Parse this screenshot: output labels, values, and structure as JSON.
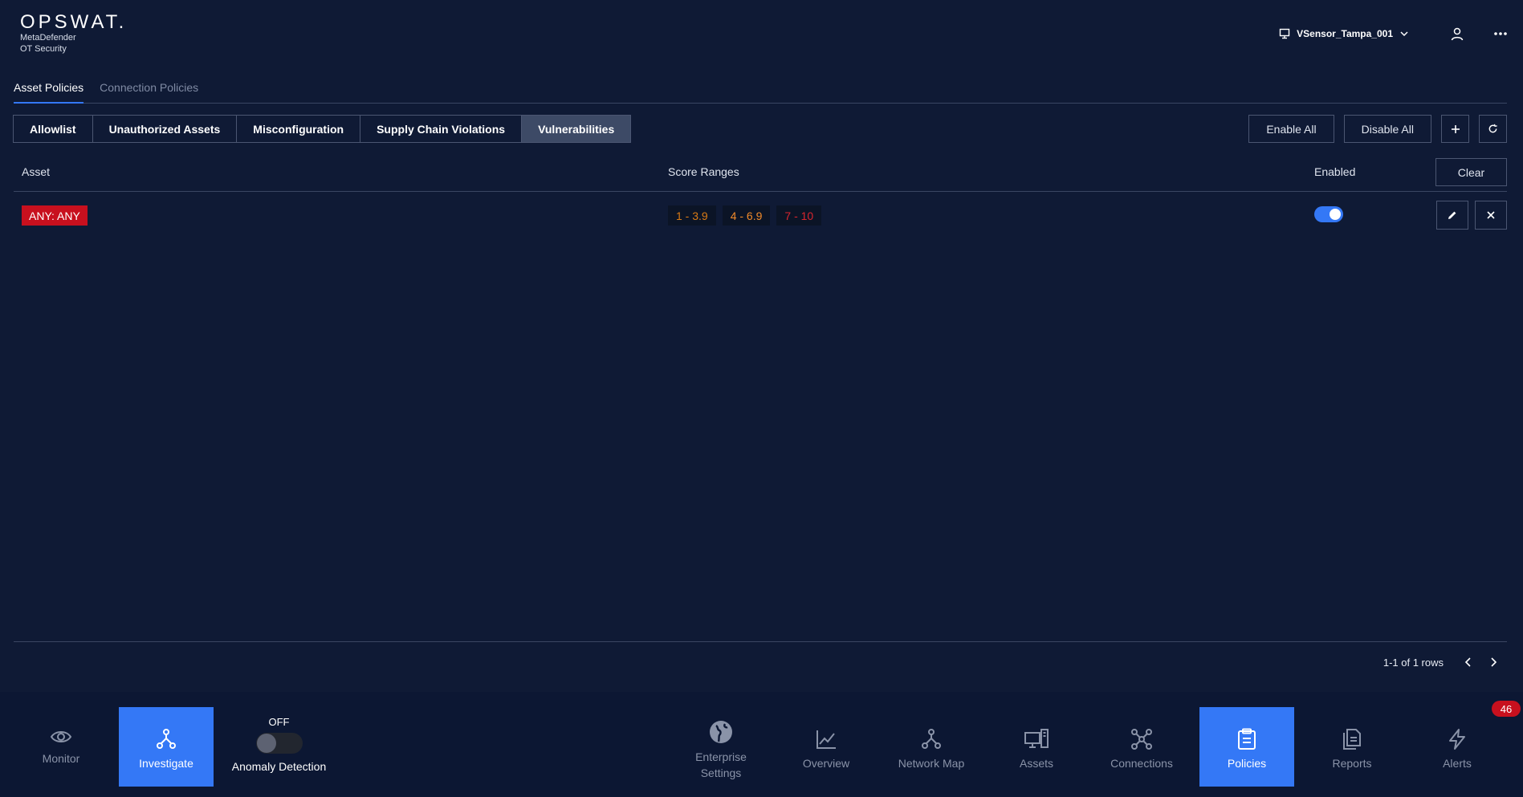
{
  "header": {
    "brand": "OPSWAT.",
    "product_line1": "MetaDefender",
    "product_line2": "OT Security",
    "sensor_name": "VSensor_Tampa_001"
  },
  "policy_tabs": [
    {
      "label": "Asset Policies",
      "active": true
    },
    {
      "label": "Connection Policies",
      "active": false
    }
  ],
  "categories": [
    {
      "label": "Allowlist",
      "active": false
    },
    {
      "label": "Unauthorized Assets",
      "active": false
    },
    {
      "label": "Misconfiguration",
      "active": false
    },
    {
      "label": "Supply Chain Violations",
      "active": false
    },
    {
      "label": "Vulnerabilities",
      "active": true
    }
  ],
  "toolbar": {
    "enable_all": "Enable All",
    "disable_all": "Disable All"
  },
  "table": {
    "columns": {
      "asset": "Asset",
      "score_ranges": "Score Ranges",
      "enabled": "Enabled",
      "clear": "Clear"
    },
    "rows": [
      {
        "asset": "ANY: ANY",
        "ranges": [
          {
            "label": "1 - 3.9",
            "color": "#d97a14"
          },
          {
            "label": "4 - 6.9",
            "color": "#f08a2a"
          },
          {
            "label": "7 - 10",
            "color": "#d8252e"
          }
        ],
        "enabled": true
      }
    ],
    "pagination": "1-1 of 1 rows"
  },
  "bottom_nav": {
    "monitor": "Monitor",
    "investigate": "Investigate",
    "anomaly_state": "OFF",
    "anomaly_label": "Anomaly Detection",
    "enterprise_line1": "Enterprise",
    "enterprise_line2": "Settings",
    "overview": "Overview",
    "network_map": "Network Map",
    "assets": "Assets",
    "connections": "Connections",
    "policies": "Policies",
    "reports": "Reports",
    "alerts": "Alerts",
    "alerts_count": "46"
  },
  "colors": {
    "background": "#0f1a35",
    "accent": "#3478f6",
    "danger": "#c8101e"
  }
}
